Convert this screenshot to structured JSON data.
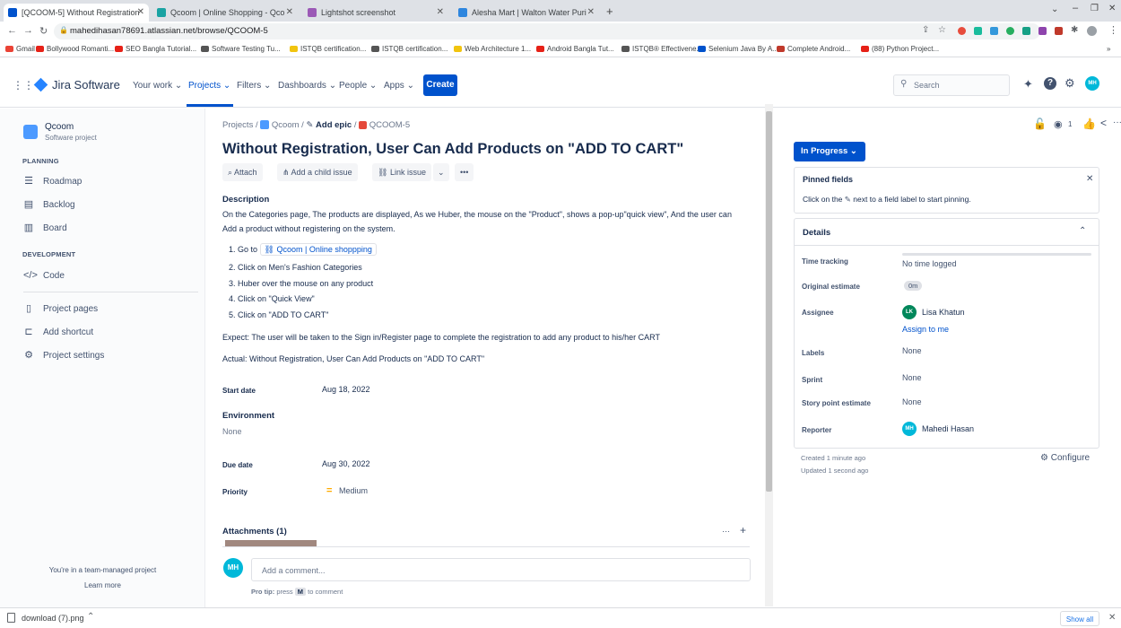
{
  "browser": {
    "tabs": [
      {
        "title": "[QCOOM-5] Without Registration",
        "active": true,
        "color": "#0052cc"
      },
      {
        "title": "Qcoom | Online Shopping - Qco",
        "active": false,
        "color": "#1aa3a3"
      },
      {
        "title": "Lightshot screenshot",
        "active": false,
        "color": "#9b59b6"
      },
      {
        "title": "Alesha Mart | Walton Water Puri",
        "active": false,
        "color": "#2e86de"
      }
    ],
    "url": "mahedihasan78691.atlassian.net/browse/QCOOM-5",
    "bookmarks": [
      {
        "label": "Gmail",
        "color": "#ea4335"
      },
      {
        "label": "Bollywood Romanti...",
        "color": "#e62117"
      },
      {
        "label": "SEO Bangla Tutorial...",
        "color": "#e62117"
      },
      {
        "label": "Software Testing Tu...",
        "color": "#555555"
      },
      {
        "label": "ISTQB certification...",
        "color": "#f1c40f"
      },
      {
        "label": "ISTQB certification...",
        "color": "#555555"
      },
      {
        "label": "Web Architecture 1...",
        "color": "#f1c40f"
      },
      {
        "label": "Android Bangla Tut...",
        "color": "#e62117"
      },
      {
        "label": "ISTQB® Effectivene...",
        "color": "#555555"
      },
      {
        "label": "Selenium Java By A...",
        "color": "#0052cc"
      },
      {
        "label": "Complete Android...",
        "color": "#c0392b"
      },
      {
        "label": "(88) Python Project...",
        "color": "#e62117"
      }
    ],
    "bookmarks_more": "»"
  },
  "nav": {
    "app_name": "Jira Software",
    "items": [
      "Your work ⌄",
      "Projects ⌄",
      "Filters ⌄",
      "Dashboards ⌄",
      "People ⌄",
      "Apps ⌄"
    ],
    "create_label": "Create",
    "search_placeholder": "Search",
    "avatar_initials": "MH"
  },
  "sidebar": {
    "project_name": "Qcoom",
    "project_type": "Software project",
    "planning_heading": "PLANNING",
    "planning_items": [
      "Roadmap",
      "Backlog",
      "Board"
    ],
    "development_heading": "DEVELOPMENT",
    "development_items": [
      "Code"
    ],
    "other_items": [
      "Project pages",
      "Add shortcut",
      "Project settings"
    ],
    "footer_text": "You're in a team-managed project",
    "footer_link": "Learn more"
  },
  "issue": {
    "breadcrumb_projects": "Projects",
    "breadcrumb_sep1": "/",
    "breadcrumb_project": "Qcoom",
    "breadcrumb_sep2": "/",
    "breadcrumb_epic": "Add epic",
    "breadcrumb_sep3": "/",
    "breadcrumb_key": "QCOOM-5",
    "title": "Without Registration, User Can Add Products on \"ADD TO CART\"",
    "actions": {
      "attach": "Attach",
      "child": "Add a child issue",
      "link": "Link issue",
      "more": "•••"
    },
    "description_label": "Description",
    "description_line1": "On the Categories page, The products are displayed, As we Huber, the mouse on the \"Product\", shows a pop-up\"quick view\", And the user can",
    "description_line2": "Add a product without registering on the system.",
    "steps_prefix": "1. Go to",
    "steps_link": "Qcoom | Online shoppping",
    "steps": [
      "2. Click on Men's Fashion Categories",
      "3. Huber over the mouse on any product",
      "4. Click on \"Quick View\"",
      "5. Click on \"ADD TO CART\""
    ],
    "expect": "Expect: The user will be taken to the Sign in/Register page to complete the registration to add any product to his/her CART",
    "actual": "Actual: Without Registration, User Can Add Products on \"ADD TO CART\"",
    "start_date_label": "Start date",
    "start_date": "Aug 18, 2022",
    "environment_label": "Environment",
    "environment_value": "None",
    "due_date_label": "Due date",
    "due_date": "Aug 30, 2022",
    "priority_label": "Priority",
    "priority_value": "Medium",
    "attachments_label": "Attachments (1)",
    "attachments_more": "···",
    "attachments_add": "+",
    "comment_avatar": "MH",
    "comment_placeholder": "Add a comment...",
    "pro_tip_prefix": "Pro tip:",
    "pro_tip_mid": "press",
    "pro_tip_key": "M",
    "pro_tip_suffix": "to comment"
  },
  "panel": {
    "watch_count": "1",
    "status": "In Progress ⌄",
    "pinned_title": "Pinned fields",
    "pinned_hint_a": "Click on the",
    "pinned_hint_b": "next to a field label to start pinning.",
    "details_title": "Details",
    "time_tracking_label": "Time tracking",
    "time_tracking_value": "No time logged",
    "original_estimate_label": "Original estimate",
    "original_estimate_value": "0m",
    "assignee_label": "Assignee",
    "assignee_initials": "LK",
    "assignee_name": "Lisa Khatun",
    "assign_to_me": "Assign to me",
    "labels_label": "Labels",
    "labels_value": "None",
    "sprint_label": "Sprint",
    "sprint_value": "None",
    "story_points_label": "Story point estimate",
    "story_points_value": "None",
    "reporter_label": "Reporter",
    "reporter_initials": "MH",
    "reporter_name": "Mahedi Hasan",
    "created": "Created 1 minute ago",
    "updated": "Updated 1 second ago",
    "configure": "Configure"
  },
  "download": {
    "file": "download (7).png",
    "show_all": "Show all"
  },
  "colors": {
    "brand": "#0052cc",
    "medium": "#ffab00",
    "assignee": "#00875a",
    "avatar": "#00b8d9"
  }
}
